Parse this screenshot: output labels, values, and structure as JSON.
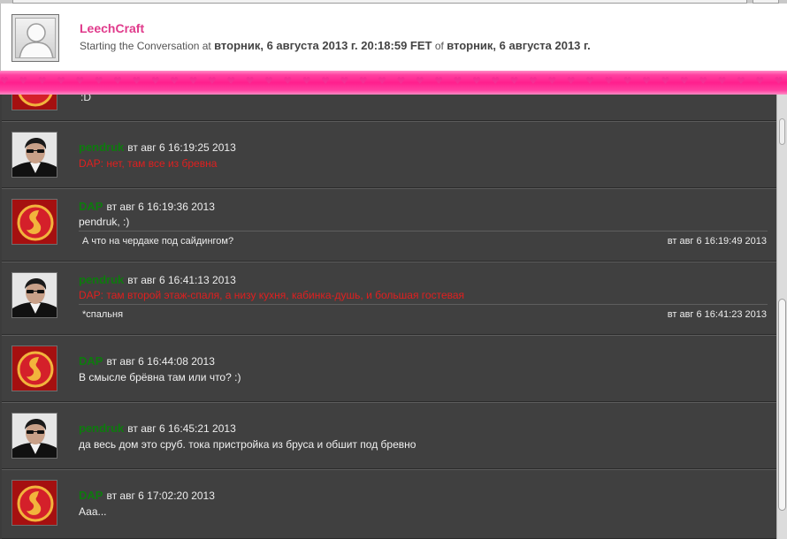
{
  "header": {
    "title": "LeechCraft",
    "subtitle_prefix": "Starting the Conversation at",
    "start_datetime": "вторник, 6 августа 2013 г. 20:18:59 FET",
    "subtitle_of": "of",
    "start_date": "вторник, 6 августа 2013 г."
  },
  "band": {
    "pattern": "♥ ♥ ♥ ♥ ♥ ♥ ♥ ♥ ♥ ♥ ♥ ♥ ♥ ♥ ♥ ♥ ♥ ♥ ♥ ♥ ♥ ♥ ♥ ♥ ♥ ♥ ♥ ♥ ♥ ♥ ♥ ♥ ♥ ♥ ♥ ♥ ♥ ♥ ♥ ♥ ♥ ♥ ♥ ♥ ♥ ♥ ♥ ♥ ♥ ♥ ♥ ♥ ♥ ♥ ♥ ♥ ♥ ♥ ♥ ♥"
  },
  "partial_message": {
    "text": ":D"
  },
  "messages": [
    {
      "nick": "pendruk",
      "time": "вт авг 6 16:19:25 2013",
      "text": "DAP: нет, там все из бревна",
      "highlight": true
    },
    {
      "nick": "DAP",
      "time": "вт авг 6 16:19:36 2013",
      "text": "pendruk, :)",
      "sub_text": "А что на чердаке под сайдингом?",
      "sub_time": "вт авг 6 16:19:49 2013"
    },
    {
      "nick": "pendruk",
      "time": "вт авг 6 16:41:13 2013",
      "text": "DAP: там второй этаж-спаля, а низу кухня, кабинка-душь, и большая гостевая",
      "highlight": true,
      "sub_text": "*спальня",
      "sub_time": "вт авг 6 16:41:23 2013"
    },
    {
      "nick": "DAP",
      "time": "вт авг 6 16:44:08 2013",
      "text": "В смысле брёвна там или что? :)"
    },
    {
      "nick": "pendruk",
      "time": "вт авг 6 16:45:21 2013",
      "text": "да весь дом это сруб. тока пристройка из бруса и обшит под бревно"
    },
    {
      "nick": "DAP",
      "time": "вт авг 6 17:02:20 2013",
      "text": "Ааа..."
    }
  ],
  "colors": {
    "title_pink": "#e03a8b",
    "nick_green": "#0e7a0e",
    "highlight_red": "#e01f1f",
    "chat_bg": "#404040"
  },
  "icons": {
    "header_avatar": "default-user-icon",
    "dap_avatar": "dragon-emblem-icon",
    "pendruk_avatar": "user-photo-icon"
  }
}
